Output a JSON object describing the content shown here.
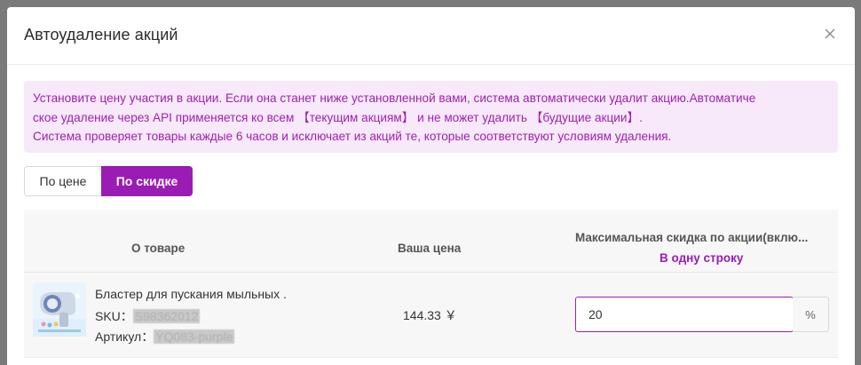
{
  "modal": {
    "title": "Автоудаление акций"
  },
  "notice": {
    "line1": "Установите цену участия в акции. Если она станет ниже установленной вами, система автоматически удалит акцию.Автоматиче",
    "line2": "ское удаление через API применяется ко всем 【текущим акциям】 и не может удалить 【будущие акции】.",
    "line3": "Система проверяет товары каждые 6 часов и исключает из акций те, которые соответствуют условиям удаления."
  },
  "mode_toggle": {
    "by_price": "По цене",
    "by_discount": "По скидке",
    "selected": "По скидке",
    "accent_color": "#9a1cb4"
  },
  "table": {
    "columns": {
      "product": "О товаре",
      "price": "Ваша цена",
      "discount": "Максимальная скидка по акции(вклю...",
      "discount_link": "В одну строку"
    },
    "rows": [
      {
        "name": "Бластер для пускания мыльных .",
        "sku_label": "SKU：",
        "sku_value": "S98362012",
        "article_label": "Артикул：",
        "article_value": "YQ083-purple",
        "price": "144.33 ￥",
        "discount_value": "20",
        "discount_unit": "%"
      }
    ]
  }
}
